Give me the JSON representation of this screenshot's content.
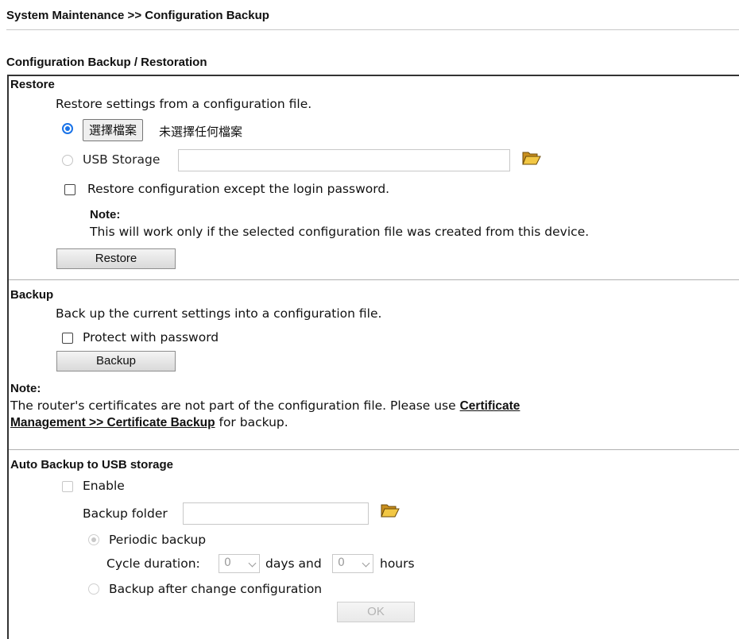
{
  "breadcrumb": "System Maintenance >> Configuration Backup",
  "section_title": "Configuration Backup / Restoration",
  "restore": {
    "heading": "Restore",
    "description": "Restore settings from a configuration file.",
    "choose_file_label": "選擇檔案",
    "no_file_text": "未選擇任何檔案",
    "usb_label": "USB Storage",
    "usb_path_value": "",
    "except_password_label": "Restore configuration except the login password.",
    "note_label": "Note:",
    "note_text": "This will work only if the selected configuration file was created from this device.",
    "button_label": "Restore"
  },
  "backup": {
    "heading": "Backup",
    "description": "Back up the current settings into a configuration file.",
    "protect_label": "Protect with password",
    "button_label": "Backup",
    "note_label": "Note:",
    "note_text_1": "The router's certificates are not part of the configuration file. Please use ",
    "note_link_1": "Certificate",
    "note_link_2": "Management >> Certificate Backup",
    "note_text_2": " for backup."
  },
  "auto_backup": {
    "heading": "Auto Backup to USB storage",
    "enable_label": "Enable",
    "folder_label": "Backup folder",
    "folder_value": "",
    "periodic_label": "Periodic backup",
    "cycle_label": "Cycle duration:",
    "days_value": "0",
    "days_label": "days and",
    "hours_value": "0",
    "hours_label": "hours",
    "after_change_label": "Backup after change configuration",
    "ok_label": "OK"
  },
  "icons": {
    "folder_icon": "open-folder",
    "folder_color": "#e8b830"
  }
}
